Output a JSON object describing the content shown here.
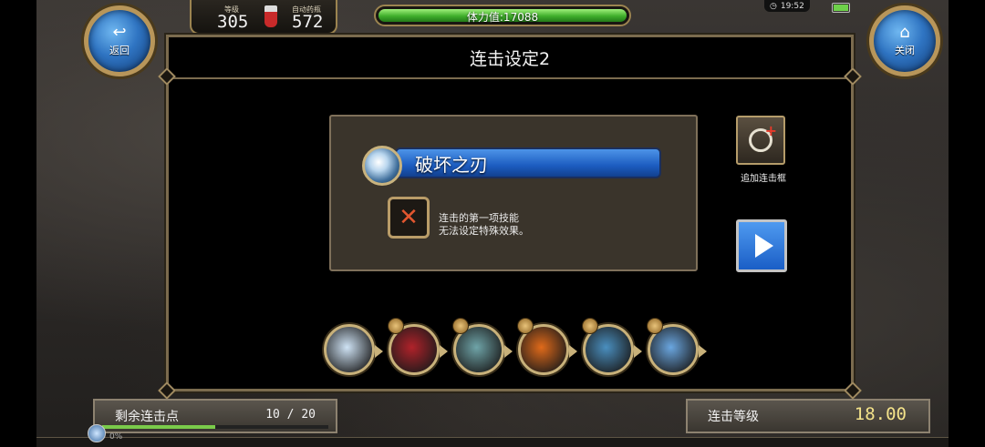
{
  "header": {
    "back_label": "返回",
    "close_label": "关闭",
    "level_label": "等级",
    "level_value": "305",
    "auto_potion_label": "自动药瓶",
    "auto_potion_value": "572",
    "hp_text": "体力值:17088",
    "hp_fraction": 1.0,
    "clock": "19:52"
  },
  "dialog": {
    "title": "连击设定2",
    "skill_name": "破坏之刃",
    "note": "连击的第一项技能\n无法设定特殊效果。",
    "add_frame_label": "追加连击框"
  },
  "skills": [
    {
      "name": "skill-blade-icon",
      "color": "#cfe3f5"
    },
    {
      "name": "skill-red-slash-icon",
      "color": "#b0222a"
    },
    {
      "name": "skill-aura-icon",
      "color": "#6fa4a8"
    },
    {
      "name": "skill-fire-arc-icon",
      "color": "#e06a1a"
    },
    {
      "name": "skill-wind-spear-icon",
      "color": "#4a8fbf"
    },
    {
      "name": "skill-sword-icon",
      "color": "#6aa6e0"
    }
  ],
  "footer": {
    "remaining_label": "剩余连击点",
    "remaining_value": "10 / 20",
    "remaining_fraction": 0.5,
    "combo_level_label": "连击等级",
    "combo_level_value": "18.00",
    "mini_text": "0%"
  }
}
